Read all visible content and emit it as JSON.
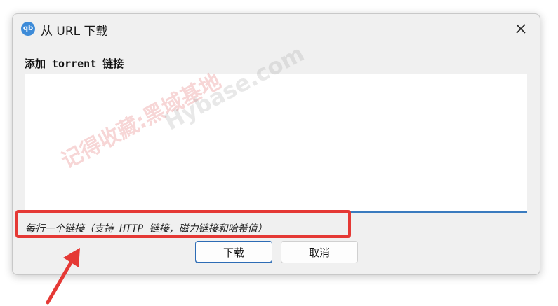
{
  "window": {
    "title": "从 URL 下载",
    "logo_text": "qb"
  },
  "form": {
    "label": "添加 torrent 链接",
    "input_value": "",
    "hint": "每行一个链接（支持 HTTP 链接，磁力链接和哈希值）"
  },
  "buttons": {
    "download": "下载",
    "cancel": "取消"
  },
  "watermark": {
    "red_text": "记得收藏:黑域基地",
    "grey_text": "Hybase.com"
  },
  "colors": {
    "accent": "#2d6cb5",
    "highlight": "#e53935",
    "dialog_bg": "#f0f0f0"
  }
}
